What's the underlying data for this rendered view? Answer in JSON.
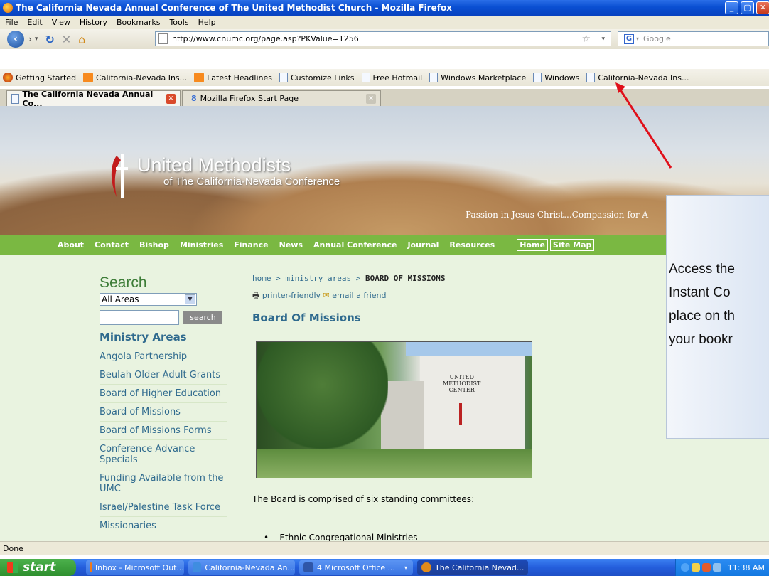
{
  "window": {
    "title": "The California Nevada Annual Conference of The United Methodist Church - Mozilla Firefox",
    "minimize": "_",
    "maximize": "▢",
    "close": "✕"
  },
  "menu": [
    "File",
    "Edit",
    "View",
    "History",
    "Bookmarks",
    "Tools",
    "Help"
  ],
  "navbar": {
    "url": "http://www.cnumc.org/page.asp?PKValue=1256",
    "search_placeholder": "Google",
    "search_engine": "G"
  },
  "bookmarks": [
    {
      "label": "Getting Started",
      "icon": "firefox-icon"
    },
    {
      "label": "California-Nevada Ins...",
      "icon": "rss-icon"
    },
    {
      "label": "Latest Headlines",
      "icon": "rss-icon"
    },
    {
      "label": "Customize Links",
      "icon": "page-icon"
    },
    {
      "label": "Free Hotmail",
      "icon": "page-icon"
    },
    {
      "label": "Windows Marketplace",
      "icon": "page-icon"
    },
    {
      "label": "Windows",
      "icon": "page-icon"
    },
    {
      "label": "California-Nevada Ins...",
      "icon": "page-icon"
    }
  ],
  "tabs": [
    {
      "label": "The California Nevada Annual Co...",
      "active": true
    },
    {
      "label": "Mozilla Firefox Start Page",
      "active": false
    }
  ],
  "site": {
    "title": "United Methodists",
    "subtitle": "of The California-Nevada Conference",
    "tagline": "Passion in Jesus Christ...Compassion for A",
    "nav": [
      "About",
      "Contact",
      "Bishop",
      "Ministries",
      "Finance",
      "News",
      "Annual Conference",
      "Journal",
      "Resources"
    ],
    "nav_boxed": [
      "Home",
      "Site Map"
    ]
  },
  "sidebar": {
    "search_title": "Search",
    "select_value": "All Areas",
    "search_button": "search",
    "ministry_title": "Ministry Areas",
    "items": [
      "Angola Partnership",
      "Beulah Older Adult Grants",
      "Board of Higher Education",
      "Board of Missions",
      "Board of Missions Forms",
      "Conference Advance Specials",
      "Funding Available from the UMC",
      "Israel/Palestine Task Force",
      "Missionaries"
    ]
  },
  "content": {
    "crumb_home": "home",
    "crumb_sep": ">",
    "crumb_ministry": "ministry areas",
    "crumb_current": "BOARD OF MISSIONS",
    "printer": "printer-friendly",
    "email": "email a friend",
    "title": "Board Of Missions",
    "photo_label": "UNITED\nMETHODIST\nCENTER",
    "description": "The Board is comprised of six standing committees:",
    "bullet1": "Ethnic Congregational Ministries"
  },
  "callout": {
    "lines": [
      "Access the",
      "Instant Co",
      "place on th",
      "your bookr"
    ]
  },
  "status": "Done",
  "taskbar": {
    "start": "start",
    "items": [
      {
        "label": "Inbox - Microsoft Out...",
        "color": "#f07a1a"
      },
      {
        "label": "California-Nevada An...",
        "color": "#3f8de0"
      },
      {
        "label": "4 Microsoft Office ...",
        "color": "#2f56a8"
      },
      {
        "label": "The California Nevad...",
        "color": "#e08a1a"
      }
    ],
    "time": "11:38 AM"
  }
}
